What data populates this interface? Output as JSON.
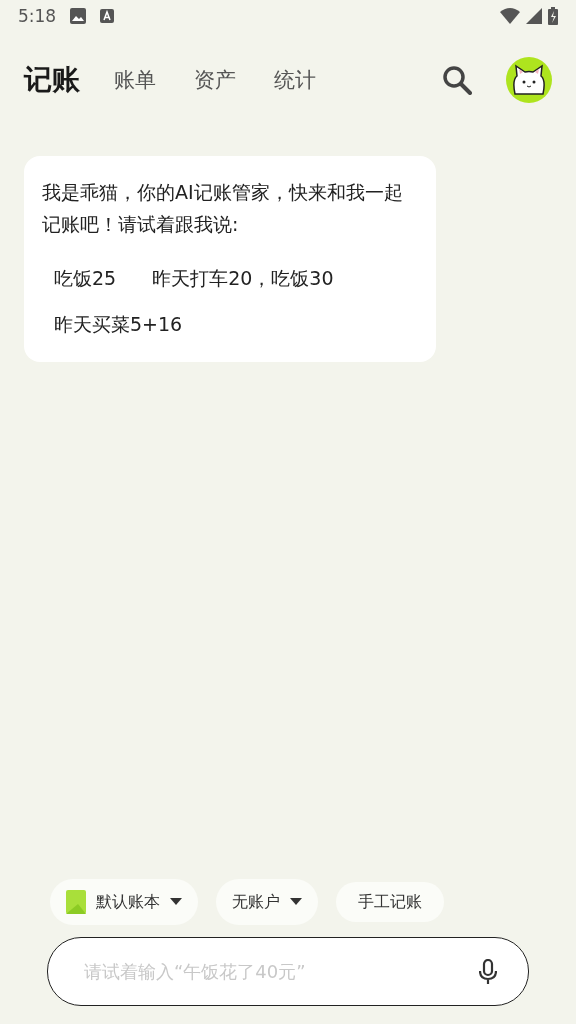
{
  "status_bar": {
    "time": "5:18"
  },
  "tabs": [
    {
      "label": "记账",
      "selected": true
    },
    {
      "label": "账单",
      "selected": false
    },
    {
      "label": "资产",
      "selected": false
    },
    {
      "label": "统计",
      "selected": false
    }
  ],
  "message": {
    "text": "我是乖猫，你的AI记账管家，快来和我一起记账吧！请试着跟我说:",
    "examples": [
      "吃饭25",
      "昨天打车20，吃饭30",
      "昨天买菜5+16"
    ]
  },
  "chips": [
    {
      "label": "默认账本",
      "kind": "book"
    },
    {
      "label": "无账户",
      "kind": "dropdown"
    },
    {
      "label": "手工记账",
      "kind": "plain"
    }
  ],
  "input": {
    "placeholder": "请试着输入“午饭花了40元”"
  }
}
